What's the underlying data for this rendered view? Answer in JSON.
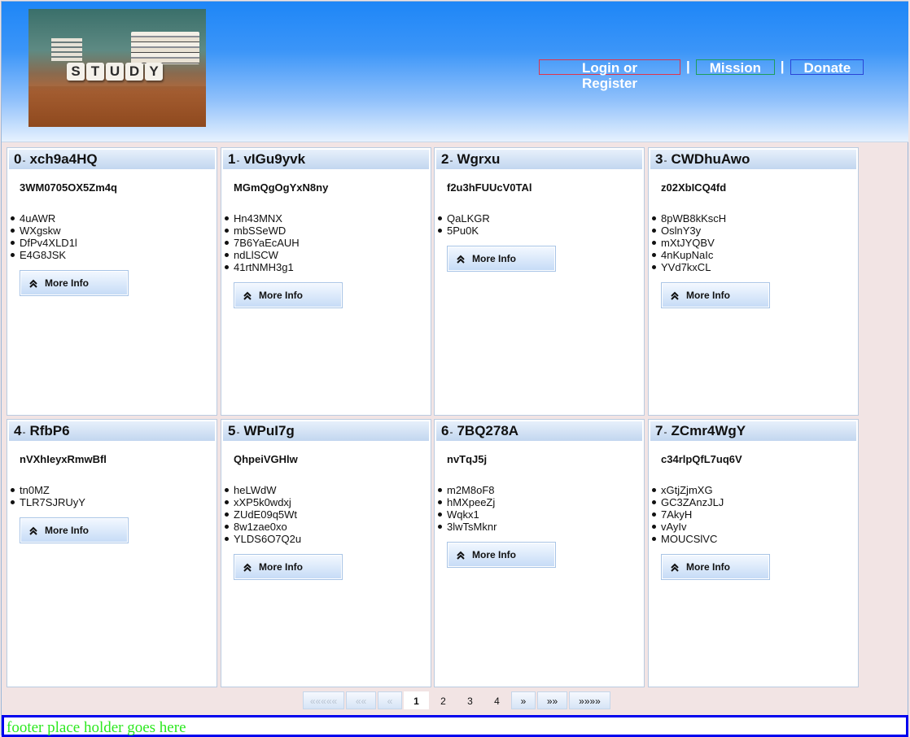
{
  "header": {
    "logo_letters": [
      "S",
      "T",
      "U",
      "D",
      "Y"
    ],
    "nav": {
      "login": "Login or Register",
      "mission": "Mission",
      "donate": "Donate",
      "separator": "|"
    }
  },
  "cards": [
    {
      "index": "0",
      "dash": "-",
      "title": "xch9a4HQ",
      "subtitle": "3WM0705OX5Zm4q",
      "items": [
        "4uAWR",
        "WXgskw",
        "DfPv4XLD1l",
        "E4G8JSK"
      ],
      "button": "More Info"
    },
    {
      "index": "1",
      "dash": "-",
      "title": "vIGu9yvk",
      "subtitle": "MGmQgOgYxN8ny",
      "items": [
        "Hn43MNX",
        "mbSSeWD",
        "7B6YaEcAUH",
        "ndLlSCW",
        "41rtNMH3g1"
      ],
      "button": "More Info"
    },
    {
      "index": "2",
      "dash": "-",
      "title": "Wgrxu",
      "subtitle": "f2u3hFUUcV0TAl",
      "items": [
        "QaLKGR",
        "5Pu0K"
      ],
      "button": "More Info"
    },
    {
      "index": "3",
      "dash": "-",
      "title": "CWDhuAwo",
      "subtitle": "z02XbICQ4fd",
      "items": [
        "8pWB8kKscH",
        "OslnY3y",
        "mXtJYQBV",
        "4nKupNaIc",
        "YVd7kxCL"
      ],
      "button": "More Info"
    },
    {
      "index": "4",
      "dash": "-",
      "title": "RfbP6",
      "subtitle": "nVXhIeyxRmwBfl",
      "items": [
        "tn0MZ",
        "TLR7SJRUyY"
      ],
      "button": "More Info"
    },
    {
      "index": "5",
      "dash": "-",
      "title": "WPuI7g",
      "subtitle": "QhpeiVGHlw",
      "items": [
        "heLWdW",
        "xXP5k0wdxj",
        "ZUdE09q5Wt",
        "8w1zae0xo",
        "YLDS6O7Q2u"
      ],
      "button": "More Info"
    },
    {
      "index": "6",
      "dash": "-",
      "title": "7BQ278A",
      "subtitle": "nvTqJ5j",
      "items": [
        "m2M8oF8",
        "hMXpeeZj",
        "Wqkx1",
        "3lwTsMknr"
      ],
      "button": "More Info"
    },
    {
      "index": "7",
      "dash": "-",
      "title": "ZCmr4WgY",
      "subtitle": "c34rlpQfL7uq6V",
      "items": [
        "xGtjZjmXG",
        "GC3ZAnzJLJ",
        "7AkyH",
        "vAyIv",
        "MOUCSlVC"
      ],
      "button": "More Info"
    }
  ],
  "pagination": {
    "first": "«««««",
    "prev_many": "««",
    "prev": "«",
    "pages": [
      "1",
      "2",
      "3",
      "4"
    ],
    "current": "1",
    "next": "»",
    "next_many": "»»",
    "last": "»»»»"
  },
  "footer": {
    "text": "footer place holder goes here"
  },
  "colors": {
    "accent": "#1e86f7",
    "footer_text": "#2de820",
    "footer_border": "#0000ee"
  }
}
